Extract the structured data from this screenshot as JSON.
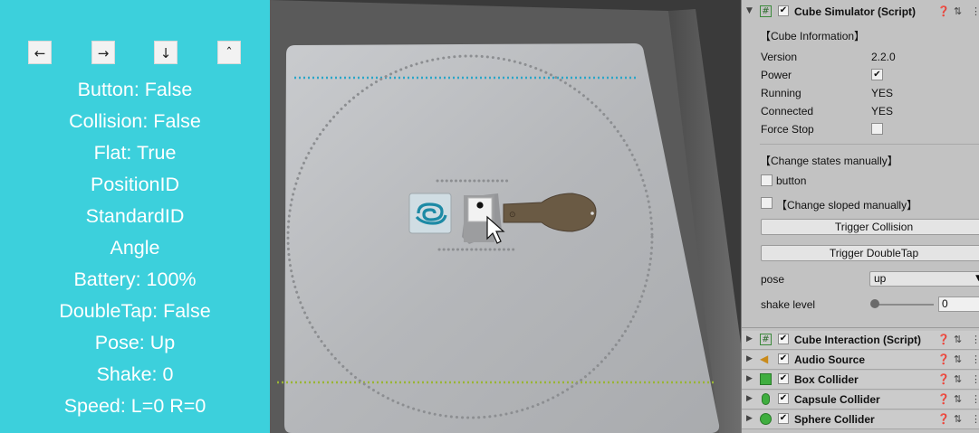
{
  "controls": {
    "left": "←",
    "right": "→",
    "down": "↓",
    "up": "ˆ"
  },
  "status": {
    "button": "Button: False",
    "collision": "Collision: False",
    "flat": "Flat: True",
    "position_id": "PositionID",
    "standard_id": "StandardID",
    "angle": "Angle",
    "battery": "Battery: 100%",
    "double_tap": "DoubleTap: False",
    "pose": "Pose: Up",
    "shake": "Shake: 0",
    "speed": "Speed: L=0 R=0"
  },
  "inspector": {
    "simulator": {
      "title": "Cube Simulator (Script)",
      "enabled": true,
      "info_section": "【Cube Information】",
      "version_label": "Version",
      "version_value": "2.2.0",
      "power_label": "Power",
      "power_checked": true,
      "running_label": "Running",
      "running_value": "YES",
      "connected_label": "Connected",
      "connected_value": "YES",
      "force_stop_label": "Force Stop",
      "force_stop_checked": false,
      "manual_section": "【Change states manually】",
      "button_label": "button",
      "sloped_label": "【Change sloped manually】",
      "trigger_collision": "Trigger Collision",
      "trigger_double_tap": "Trigger DoubleTap",
      "pose_label": "pose",
      "pose_value": "up",
      "shake_label": "shake level",
      "shake_value": "0"
    },
    "components": [
      {
        "title": "Cube Interaction (Script)",
        "icon": "script-icon"
      },
      {
        "title": "Audio Source",
        "icon": "audio-source-icon"
      },
      {
        "title": "Box Collider",
        "icon": "box-collider-icon"
      },
      {
        "title": "Capsule Collider",
        "icon": "capsule-collider-icon"
      },
      {
        "title": "Sphere Collider",
        "icon": "sphere-collider-icon"
      }
    ]
  },
  "colors": {
    "status_panel_bg": "#3cd0dc",
    "inspector_bg": "#c2c2c2",
    "mat_surface": "#b7b9bc",
    "top_dotted_line": "#2aa6c8",
    "bottom_dotted_line": "#9ab534",
    "stand": "#6a5a44",
    "cube_body": "#9c9d9f",
    "mat_logo": "#1d8aa5"
  }
}
